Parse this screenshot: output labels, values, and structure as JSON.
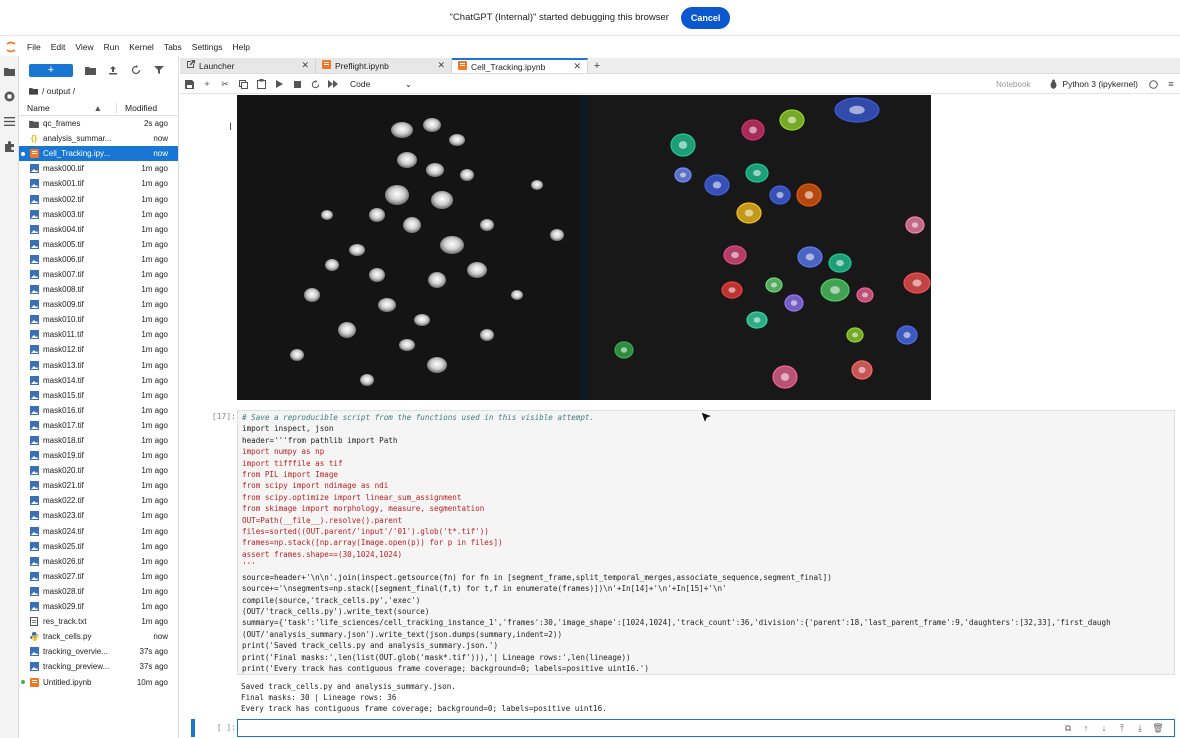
{
  "debug_banner": {
    "message": "\"ChatGPT (Internal)\" started debugging this browser",
    "cancel_label": "Cancel"
  },
  "menu": [
    "File",
    "Edit",
    "View",
    "Run",
    "Kernel",
    "Tabs",
    "Settings",
    "Help"
  ],
  "file_browser": {
    "new_label": "+",
    "path": "/ output /",
    "col_name": "Name",
    "col_modified": "Modified",
    "files": [
      {
        "name": "qc_frames",
        "modified": "2s ago",
        "type": "folder"
      },
      {
        "name": "analysis_summar...",
        "modified": "now",
        "type": "json"
      },
      {
        "name": "Cell_Tracking.ipy...",
        "modified": "now",
        "type": "notebook",
        "selected": true,
        "running": true
      },
      {
        "name": "mask000.tif",
        "modified": "1m ago",
        "type": "image"
      },
      {
        "name": "mask001.tif",
        "modified": "1m ago",
        "type": "image"
      },
      {
        "name": "mask002.tif",
        "modified": "1m ago",
        "type": "image"
      },
      {
        "name": "mask003.tif",
        "modified": "1m ago",
        "type": "image"
      },
      {
        "name": "mask004.tif",
        "modified": "1m ago",
        "type": "image"
      },
      {
        "name": "mask005.tif",
        "modified": "1m ago",
        "type": "image"
      },
      {
        "name": "mask006.tif",
        "modified": "1m ago",
        "type": "image"
      },
      {
        "name": "mask007.tif",
        "modified": "1m ago",
        "type": "image"
      },
      {
        "name": "mask008.tif",
        "modified": "1m ago",
        "type": "image"
      },
      {
        "name": "mask009.tif",
        "modified": "1m ago",
        "type": "image"
      },
      {
        "name": "mask010.tif",
        "modified": "1m ago",
        "type": "image"
      },
      {
        "name": "mask011.tif",
        "modified": "1m ago",
        "type": "image"
      },
      {
        "name": "mask012.tif",
        "modified": "1m ago",
        "type": "image"
      },
      {
        "name": "mask013.tif",
        "modified": "1m ago",
        "type": "image"
      },
      {
        "name": "mask014.tif",
        "modified": "1m ago",
        "type": "image"
      },
      {
        "name": "mask015.tif",
        "modified": "1m ago",
        "type": "image"
      },
      {
        "name": "mask016.tif",
        "modified": "1m ago",
        "type": "image"
      },
      {
        "name": "mask017.tif",
        "modified": "1m ago",
        "type": "image"
      },
      {
        "name": "mask018.tif",
        "modified": "1m ago",
        "type": "image"
      },
      {
        "name": "mask019.tif",
        "modified": "1m ago",
        "type": "image"
      },
      {
        "name": "mask020.tif",
        "modified": "1m ago",
        "type": "image"
      },
      {
        "name": "mask021.tif",
        "modified": "1m ago",
        "type": "image"
      },
      {
        "name": "mask022.tif",
        "modified": "1m ago",
        "type": "image"
      },
      {
        "name": "mask023.tif",
        "modified": "1m ago",
        "type": "image"
      },
      {
        "name": "mask024.tif",
        "modified": "1m ago",
        "type": "image"
      },
      {
        "name": "mask025.tif",
        "modified": "1m ago",
        "type": "image"
      },
      {
        "name": "mask026.tif",
        "modified": "1m ago",
        "type": "image"
      },
      {
        "name": "mask027.tif",
        "modified": "1m ago",
        "type": "image"
      },
      {
        "name": "mask028.tif",
        "modified": "1m ago",
        "type": "image"
      },
      {
        "name": "mask029.tif",
        "modified": "1m ago",
        "type": "image"
      },
      {
        "name": "res_track.txt",
        "modified": "1m ago",
        "type": "text"
      },
      {
        "name": "track_cells.py",
        "modified": "now",
        "type": "python"
      },
      {
        "name": "tracking_overvie...",
        "modified": "37s ago",
        "type": "image"
      },
      {
        "name": "tracking_preview...",
        "modified": "37s ago",
        "type": "image"
      },
      {
        "name": "Untitled.ipynb",
        "modified": "10m ago",
        "type": "notebook",
        "running": true
      }
    ]
  },
  "tabs": [
    {
      "label": "Launcher",
      "icon": "launcher-icon"
    },
    {
      "label": "Preflight.ipynb",
      "icon": "notebook-icon"
    },
    {
      "label": "Cell_Tracking.ipynb",
      "icon": "notebook-icon",
      "active": true
    }
  ],
  "toolbar": {
    "cell_type": "Code",
    "notebook_label": "Notebook",
    "kernel": "Python 3 (ipykernel)"
  },
  "cell": {
    "prompt": "[17]:",
    "new_prompt": "[ ]:",
    "code_lines": [
      "# Save a reproducible script from the functions used in this visible attempt.",
      "import inspect, json",
      "header='''from pathlib import Path",
      "import numpy as np",
      "import tifffile as tif",
      "from PIL import Image",
      "from scipy import ndimage as ndi",
      "from scipy.optimize import linear_sum_assignment",
      "from skimage import morphology, measure, segmentation",
      "OUT=Path(__file__).resolve().parent",
      "files=sorted((OUT.parent/'input'/'01').glob('t*.tif'))",
      "frames=np.stack([np.array(Image.open(p)) for p in files])",
      "assert frames.shape==(30,1024,1024)",
      "'''",
      "source=header+'\\n\\n'.join(inspect.getsource(fn) for fn in [segment_frame,split_temporal_merges,associate_sequence,segment_final])",
      "source+='\\nsegments=np.stack([segment_final(f,t) for t,f in enumerate(frames)])\\n'+In[14]+'\\n'+In[15]+'\\n'",
      "compile(source,'track_cells.py','exec')",
      "(OUT/'track_cells.py').write_text(source)",
      "summary={'task':'life_sciences/cell_tracking_instance_1','frames':30,'image_shape':[1024,1024],'track_count':36,'division':{'parent':18,'last_parent_frame':9,'daughters':[32,33],'first_daugh",
      "(OUT/'analysis_summary.json').write_text(json.dumps(summary,indent=2))",
      "print('Saved track_cells.py and analysis_summary.json.')",
      "print('Final masks:',len(list(OUT.glob('mask*.tif'))),'| Lineage rows:',len(lineage))",
      "print('Every track has contiguous frame coverage; background=0; labels=positive uint16.')"
    ],
    "output_lines": [
      "Saved track_cells.py and analysis_summary.json.",
      "Final masks: 30 | Lineage rows: 36",
      "Every track has contiguous frame coverage; background=0; labels=positive uint16."
    ]
  },
  "colors": {
    "accent": "#1976d2",
    "cancel": "#0b57d0"
  }
}
